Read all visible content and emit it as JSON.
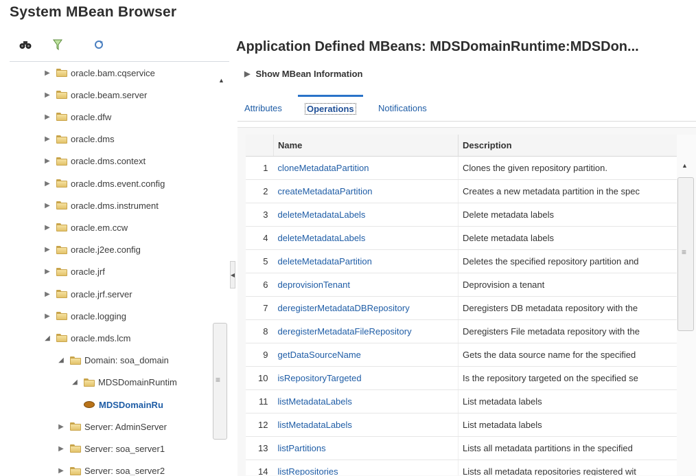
{
  "page": {
    "title": "System MBean Browser"
  },
  "toolbar": {
    "icons": [
      "binoculars-icon",
      "filter-icon",
      "refresh-icon"
    ]
  },
  "tree": {
    "items": [
      {
        "label": "oracle.bam.cqservice",
        "level": 0,
        "type": "folder",
        "expanded": false
      },
      {
        "label": "oracle.beam.server",
        "level": 0,
        "type": "folder",
        "expanded": false
      },
      {
        "label": "oracle.dfw",
        "level": 0,
        "type": "folder",
        "expanded": false
      },
      {
        "label": "oracle.dms",
        "level": 0,
        "type": "folder",
        "expanded": false
      },
      {
        "label": "oracle.dms.context",
        "level": 0,
        "type": "folder",
        "expanded": false
      },
      {
        "label": "oracle.dms.event.config",
        "level": 0,
        "type": "folder",
        "expanded": false
      },
      {
        "label": "oracle.dms.instrument",
        "level": 0,
        "type": "folder",
        "expanded": false
      },
      {
        "label": "oracle.em.ccw",
        "level": 0,
        "type": "folder",
        "expanded": false
      },
      {
        "label": "oracle.j2ee.config",
        "level": 0,
        "type": "folder",
        "expanded": false
      },
      {
        "label": "oracle.jrf",
        "level": 0,
        "type": "folder",
        "expanded": false
      },
      {
        "label": "oracle.jrf.server",
        "level": 0,
        "type": "folder",
        "expanded": false
      },
      {
        "label": "oracle.logging",
        "level": 0,
        "type": "folder",
        "expanded": false
      },
      {
        "label": "oracle.mds.lcm",
        "level": 0,
        "type": "folder",
        "expanded": true
      },
      {
        "label": "Domain: soa_domain",
        "level": 1,
        "type": "folder",
        "expanded": true
      },
      {
        "label": "MDSDomainRuntim",
        "level": 2,
        "type": "folder",
        "expanded": true
      },
      {
        "label": "MDSDomainRu",
        "level": 3,
        "type": "bean",
        "selected": true
      },
      {
        "label": "Server: AdminServer",
        "level": 1,
        "type": "folder",
        "expanded": false
      },
      {
        "label": "Server: soa_server1",
        "level": 1,
        "type": "folder",
        "expanded": false
      },
      {
        "label": "Server: soa_server2",
        "level": 1,
        "type": "folder",
        "expanded": false
      }
    ]
  },
  "main": {
    "title": "Application Defined MBeans: MDSDomainRuntime:MDSDon...",
    "show_info_label": "Show MBean Information",
    "tabs": [
      {
        "label": "Attributes",
        "active": false
      },
      {
        "label": "Operations",
        "active": true
      },
      {
        "label": "Notifications",
        "active": false
      }
    ],
    "table": {
      "headers": {
        "name": "Name",
        "description": "Description"
      },
      "rows": [
        {
          "num": "1",
          "name": "cloneMetadataPartition",
          "desc": "Clones the given repository partition."
        },
        {
          "num": "2",
          "name": "createMetadataPartition",
          "desc": "Creates a new metadata partition in the spec"
        },
        {
          "num": "3",
          "name": "deleteMetadataLabels",
          "desc": "Delete metadata labels"
        },
        {
          "num": "4",
          "name": "deleteMetadataLabels",
          "desc": "Delete metadata labels"
        },
        {
          "num": "5",
          "name": "deleteMetadataPartition",
          "desc": "Deletes the specified repository partition and"
        },
        {
          "num": "6",
          "name": "deprovisionTenant",
          "desc": "Deprovision a tenant"
        },
        {
          "num": "7",
          "name": "deregisterMetadataDBRepository",
          "desc": "Deregisters DB metadata repository with the"
        },
        {
          "num": "8",
          "name": "deregisterMetadataFileRepository",
          "desc": "Deregisters File metadata repository with the"
        },
        {
          "num": "9",
          "name": "getDataSourceName",
          "desc": "Gets the data source name for the specified"
        },
        {
          "num": "10",
          "name": "isRepositoryTargeted",
          "desc": "Is the repository targeted on the specified se"
        },
        {
          "num": "11",
          "name": "listMetadataLabels",
          "desc": "List metadata labels"
        },
        {
          "num": "12",
          "name": "listMetadataLabels",
          "desc": "List metadata labels"
        },
        {
          "num": "13",
          "name": "listPartitions",
          "desc": "Lists all metadata partitions in the specified"
        },
        {
          "num": "14",
          "name": "listRepositories",
          "desc": "Lists all metadata repositories registered wit"
        }
      ]
    }
  }
}
